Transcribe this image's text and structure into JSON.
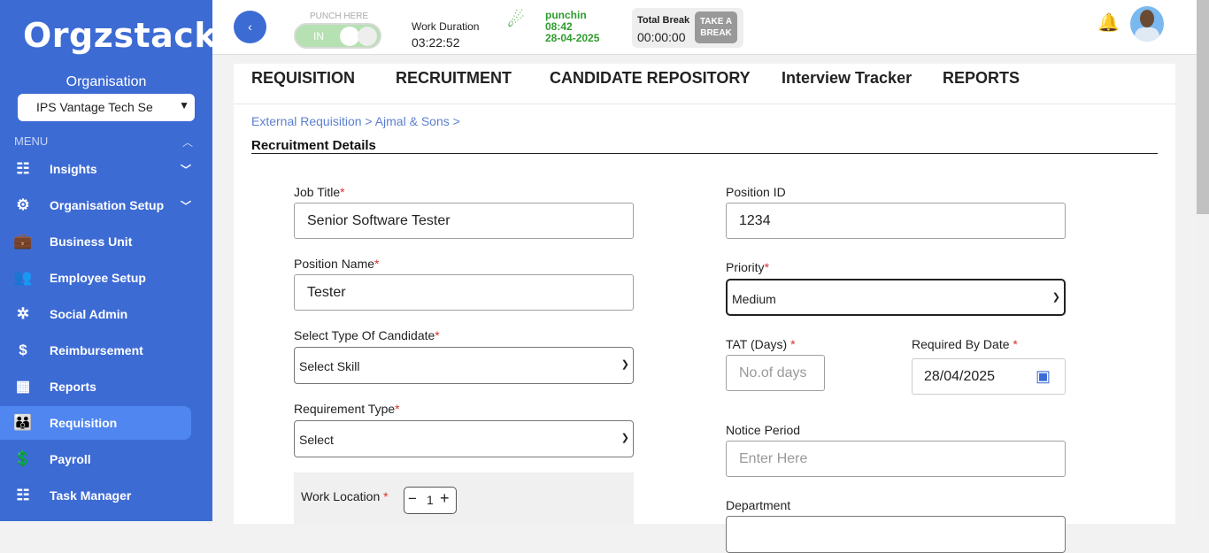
{
  "sidebar": {
    "logo": "Orgzstack",
    "org_label": "Organisation",
    "org_select_value": "IPS Vantage Tech Se",
    "menu_label": "MENU",
    "items": [
      {
        "label": "Insights",
        "icon": "dashboard-icon",
        "glyph": "☷",
        "has_chevron": true
      },
      {
        "label": "Organisation Setup",
        "icon": "org-setup-icon",
        "glyph": "⚙",
        "has_chevron": true
      },
      {
        "label": "Business Unit",
        "icon": "briefcase-icon",
        "glyph": "💼",
        "has_chevron": false
      },
      {
        "label": "Employee Setup",
        "icon": "people-settings-icon",
        "glyph": "👥",
        "has_chevron": false
      },
      {
        "label": "Social Admin",
        "icon": "social-network-icon",
        "glyph": "✲",
        "has_chevron": false
      },
      {
        "label": "Reimbursement",
        "icon": "reimbursement-icon",
        "glyph": "$",
        "has_chevron": false
      },
      {
        "label": "Reports",
        "icon": "calendar-grid-icon",
        "glyph": "▦",
        "has_chevron": false
      },
      {
        "label": "Requisition",
        "icon": "team-icon",
        "glyph": "👪",
        "has_chevron": false,
        "active": true
      },
      {
        "label": "Payroll",
        "icon": "payroll-icon",
        "glyph": "💲",
        "has_chevron": false
      },
      {
        "label": "Task Manager",
        "icon": "task-list-icon",
        "glyph": "☷",
        "has_chevron": false
      }
    ]
  },
  "topbar": {
    "punch_here_label": "PUNCH HERE",
    "punch_toggle_text": "IN",
    "work_duration_label": "Work Duration",
    "work_duration_value": "03:22:52",
    "punch_status": "punchin",
    "punch_time": "08:42",
    "punch_date": "28-04-2025",
    "total_break_label": "Total Break",
    "total_break_value": "00:00:00",
    "take_break_label": "TAKE A BREAK"
  },
  "tabs": [
    "REQUISITION",
    "RECRUITMENT",
    "CANDIDATE REPOSITORY",
    "Interview Tracker",
    "REPORTS"
  ],
  "breadcrumb": "External Requisition > Ajmal & Sons >",
  "section_title": "Recruitment Details",
  "form": {
    "job_title_label": "Job Title",
    "job_title_value": "Senior Software Tester",
    "position_id_label": "Position ID",
    "position_id_value": "1234",
    "position_name_label": "Position Name",
    "position_name_value": "Tester",
    "priority_label": "Priority",
    "priority_value": "Medium",
    "candidate_type_label": "Select Type Of Candidate",
    "candidate_type_value": "Select Skill",
    "tat_label": "TAT (Days)",
    "tat_placeholder": "No.of days",
    "required_by_label": "Required By Date",
    "required_by_value": "28/04/2025",
    "requirement_type_label": "Requirement Type",
    "requirement_type_value": "Select",
    "notice_period_label": "Notice Period",
    "notice_period_placeholder": "Enter Here",
    "work_location_label": "Work Location",
    "work_location_count": "1",
    "department_label": "Department",
    "required_mark": "*"
  }
}
